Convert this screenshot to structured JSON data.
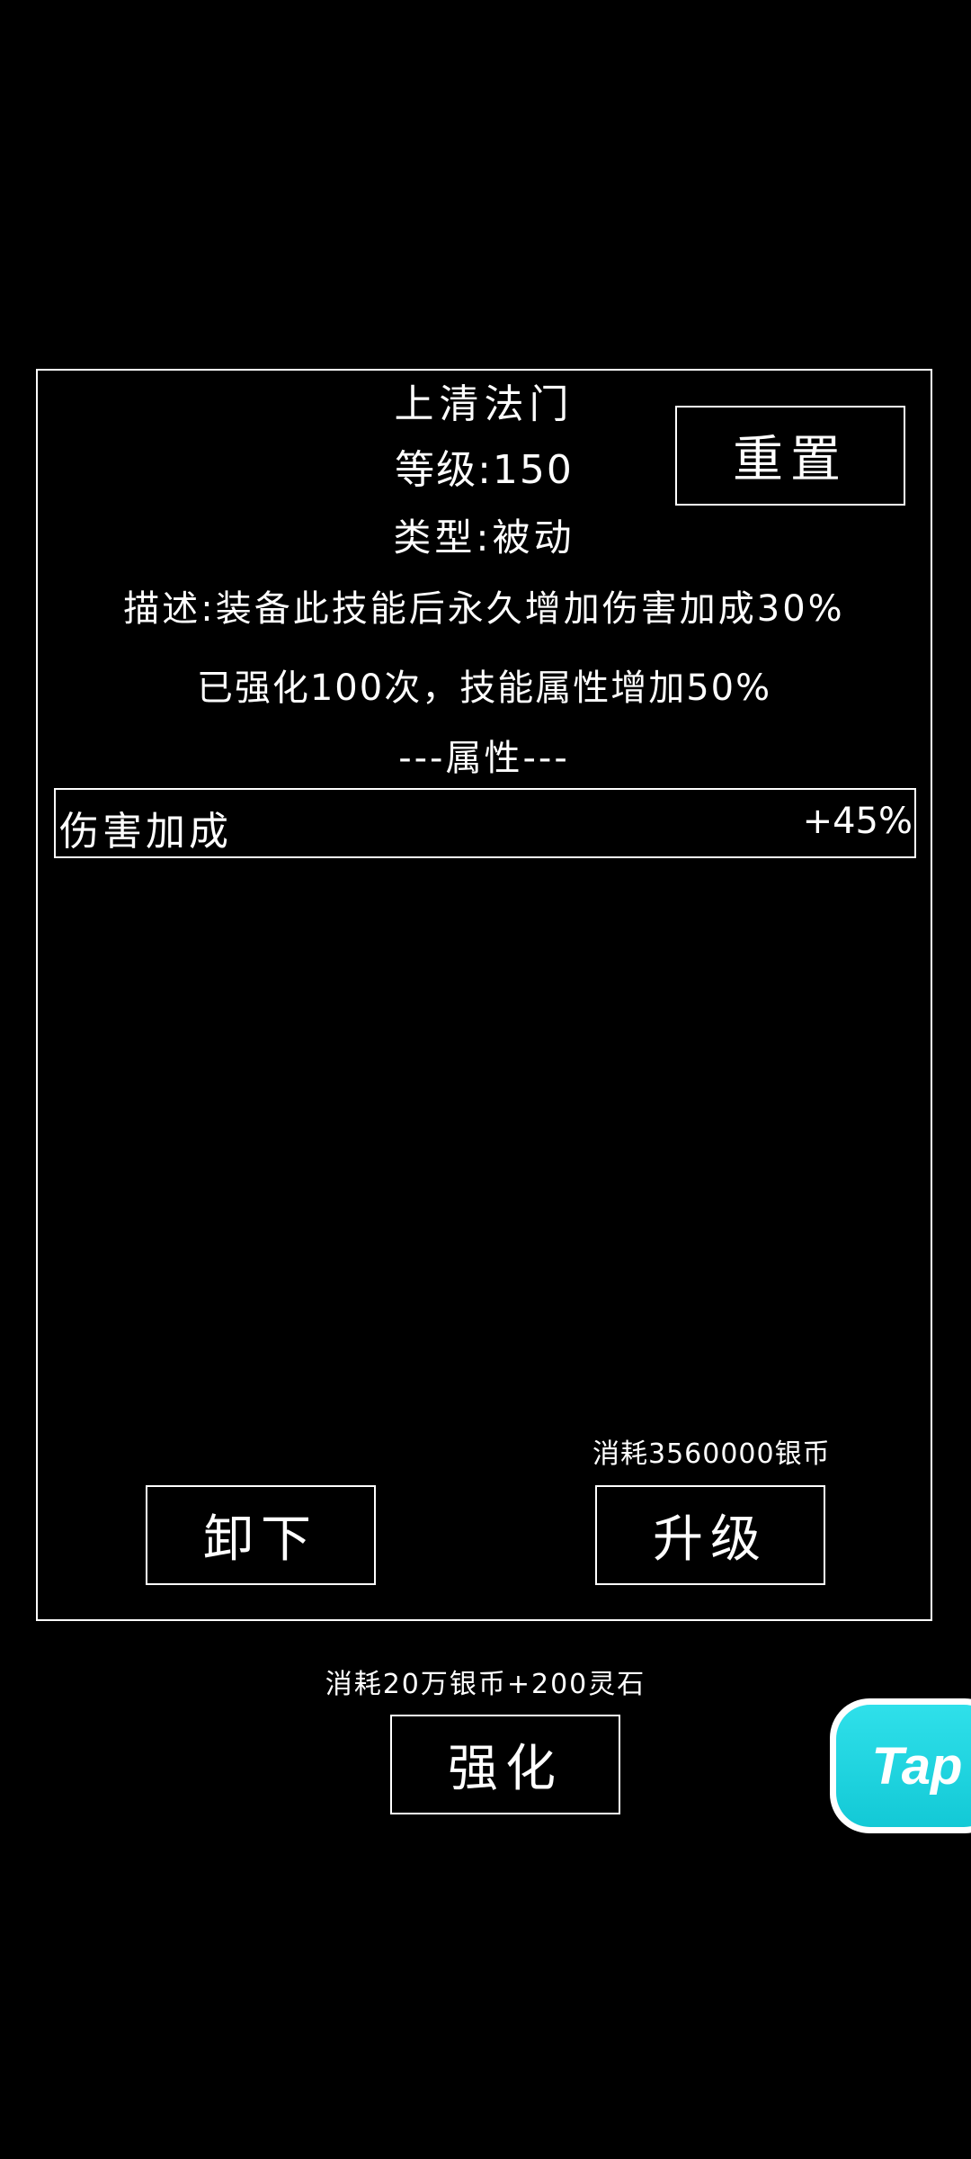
{
  "skill": {
    "name": "上清法门",
    "level_text": "等级:150",
    "type_text": "类型:被动",
    "description": "描述:装备此技能后永久增加伤害加成30%",
    "enhance_info": "已强化100次，技能属性增加50%",
    "attributes_header": "---属性---"
  },
  "attributes": [
    {
      "name": "伤害加成",
      "value": "+45%"
    }
  ],
  "buttons": {
    "reset": "重置",
    "unequip": "卸下",
    "upgrade": "升级",
    "enhance": "强化"
  },
  "costs": {
    "upgrade_cost": "消耗3560000银币",
    "enhance_cost": "消耗20万银币+200灵石"
  },
  "badge": {
    "label": "Tap",
    "color": "#19d0dd"
  }
}
